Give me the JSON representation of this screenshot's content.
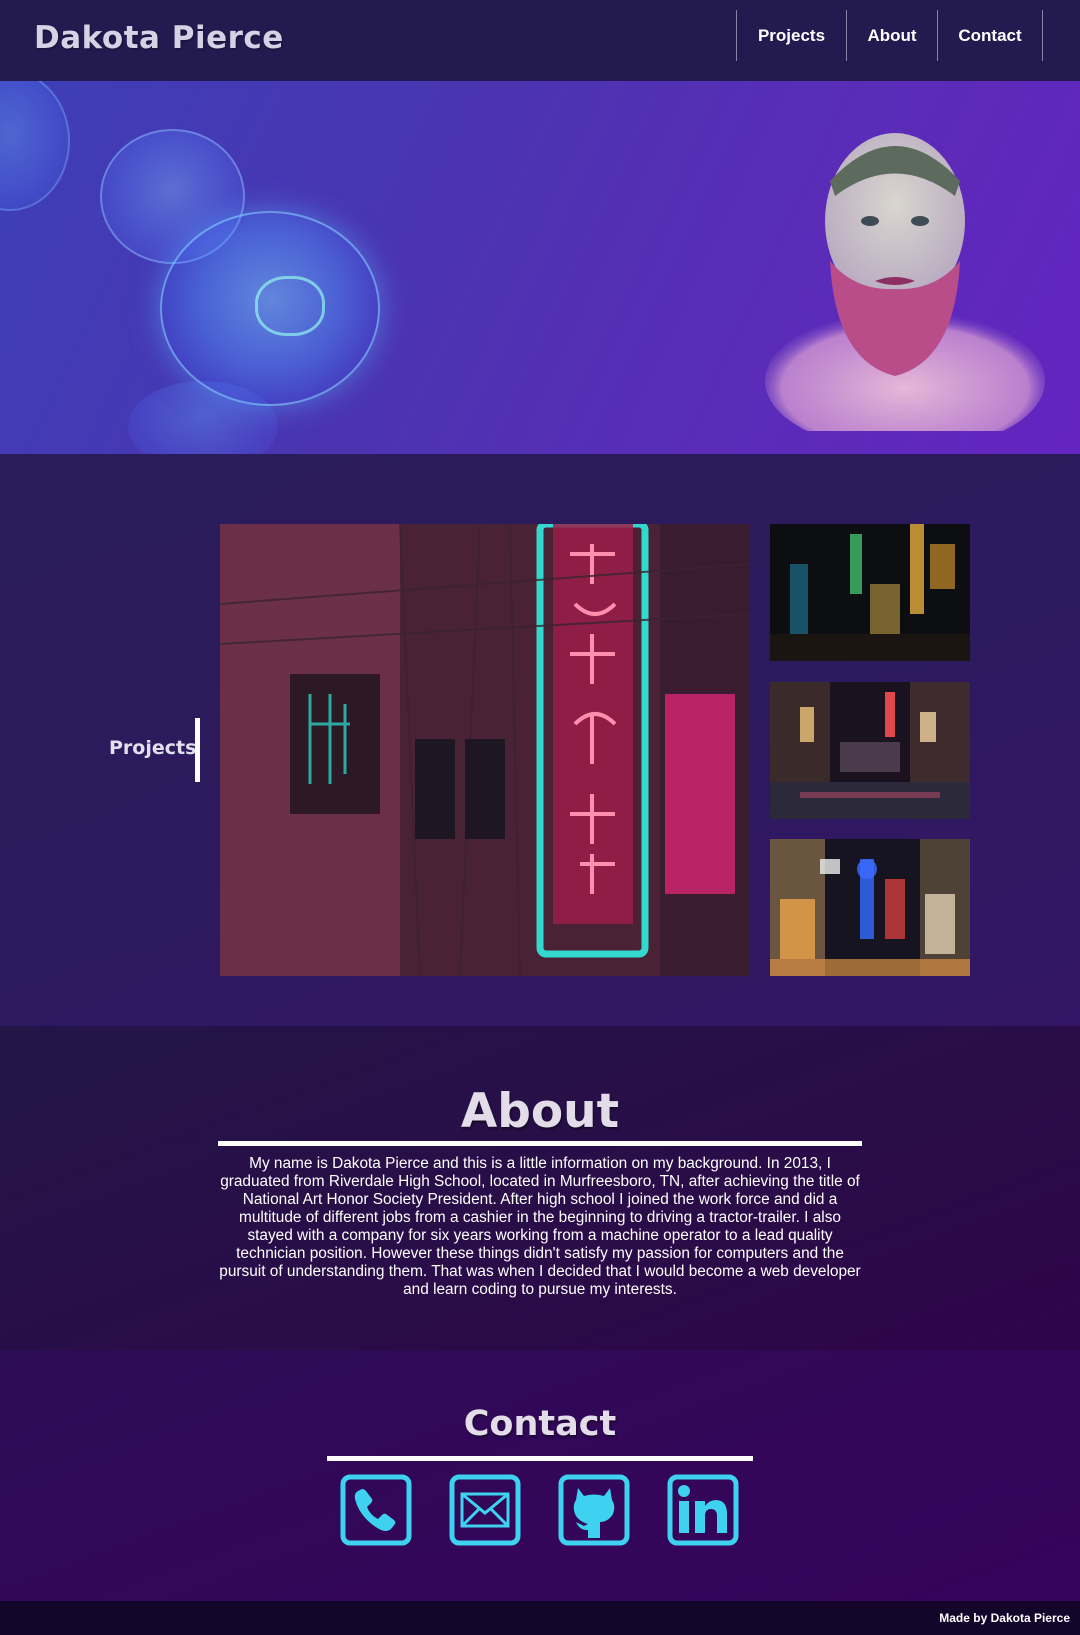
{
  "header": {
    "brand": "Dakota Pierce",
    "nav": [
      {
        "label": "Projects"
      },
      {
        "label": "About"
      },
      {
        "label": "Contact"
      }
    ]
  },
  "projects": {
    "label": "Projects",
    "images": [
      {
        "subject": "neon-sign-building"
      },
      {
        "subject": "night-alley-lights"
      },
      {
        "subject": "night-street-reflections"
      },
      {
        "subject": "osaka-tower-street"
      }
    ]
  },
  "about": {
    "title": "About",
    "text": "My name is Dakota Pierce and this is a little information on my background. In 2013, I graduated from Riverdale High School, located in Murfreesboro, TN, after achieving the title of National Art Honor Society President. After high school I joined the work force and did a multitude of different jobs from a cashier in the beginning to driving a tractor-trailer. I also stayed with a company for six years working from a machine operator to a lead quality technician position. However these things didn't satisfy my passion for computers and the pursuit of understanding them. That was when I decided that I would become a web developer and learn coding to pursue my interests."
  },
  "contact": {
    "title": "Contact",
    "icons": [
      "phone-icon",
      "mail-icon",
      "github-icon",
      "linkedin-icon"
    ],
    "icon_color": "#3fd2f0"
  },
  "footer": {
    "text": "Made by Dakota Pierce"
  },
  "colors": {
    "header_bg": "#231a50",
    "footer_bg": "#14062b",
    "accent": "#3fd2f0"
  }
}
